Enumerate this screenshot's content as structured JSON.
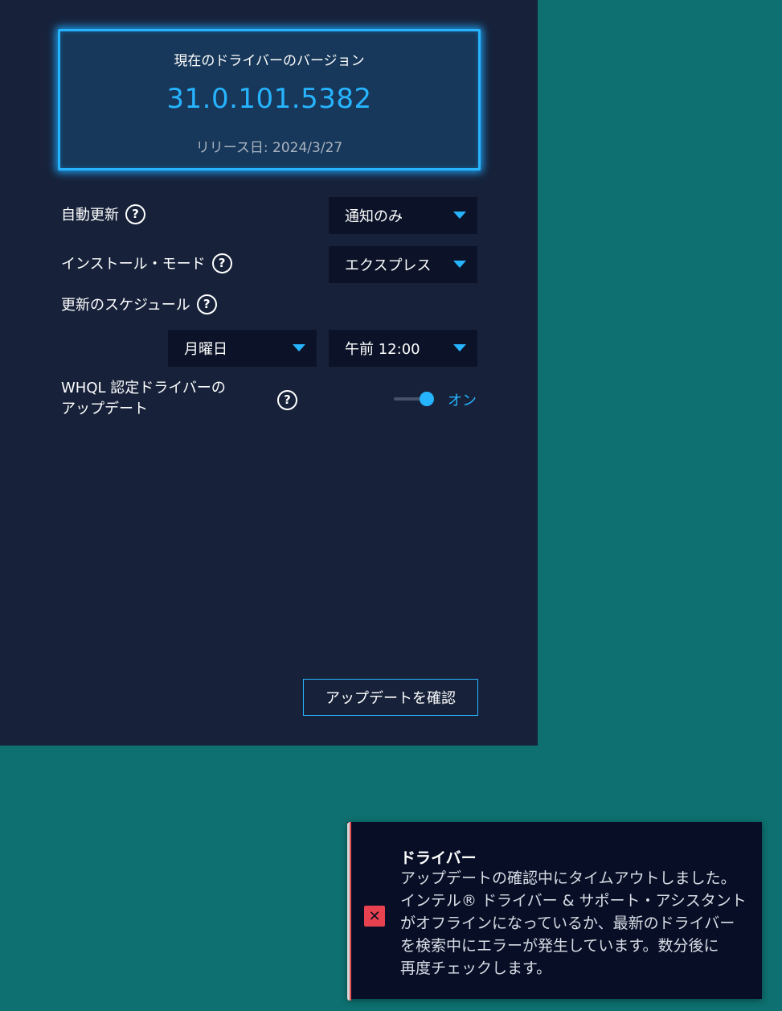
{
  "version_card": {
    "title": "現在のドライバーのバージョン",
    "version": "31.0.101.5382",
    "release_date": "リリース日: 2024/3/27"
  },
  "settings": {
    "auto_update": {
      "label": "自動更新",
      "value": "通知のみ"
    },
    "install_mode": {
      "label": "インストール・モード",
      "value": "エクスプレス"
    },
    "schedule": {
      "label": "更新のスケジュール",
      "day": "月曜日",
      "time": "午前 12:00"
    },
    "whql": {
      "label": "WHQL 認定ドライバーの\nアップデート",
      "toggle_state": "オン",
      "enabled": true
    }
  },
  "help_glyph": "?",
  "check_button_label": "アップデートを確認",
  "toast": {
    "icon": "error-icon",
    "icon_glyph": "✕",
    "title": "ドライバー",
    "message": "アップデートの確認中にタイムアウトしました。\nインテル® ドライバー & サポート・アシスタント\nがオフラインになっているか、最新のドライバー\nを検索中にエラーが発生しています。数分後に\n再度チェックします。"
  },
  "colors": {
    "accent": "#27b4ff",
    "panel": "#17223a",
    "desktop": "#0e7070",
    "error": "#e8414f"
  }
}
